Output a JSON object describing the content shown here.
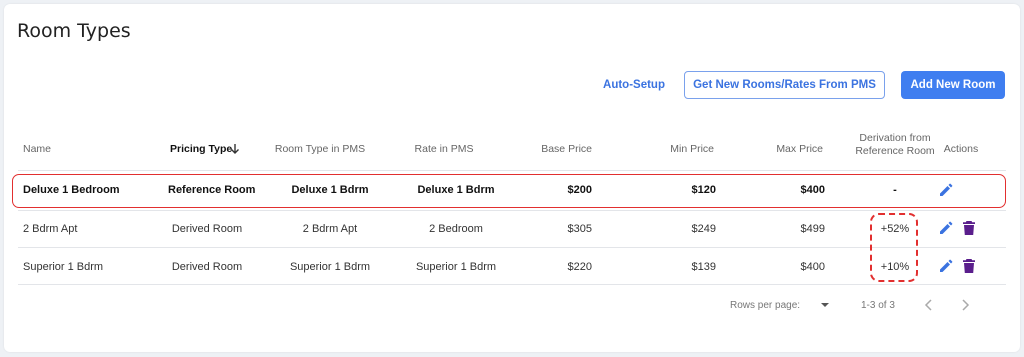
{
  "page": {
    "title": "Room Types"
  },
  "toolbar": {
    "auto_setup": "Auto-Setup",
    "get_new": "Get New Rooms/Rates From PMS",
    "add_new": "Add New Room"
  },
  "table": {
    "columns": {
      "name": "Name",
      "pricing_type": "Pricing Type",
      "room_type_pms": "Room Type in PMS",
      "rate_pms": "Rate in PMS",
      "base_price": "Base Price",
      "min_price": "Min Price",
      "max_price": "Max Price",
      "derivation_line1": "Derivation from",
      "derivation_line2": "Reference Room",
      "actions": "Actions"
    },
    "rows": [
      {
        "name": "Deluxe 1 Bedroom",
        "pricing_type": "Reference Room",
        "room_type_pms": "Deluxe 1 Bdrm",
        "rate_pms": "Deluxe 1 Bdrm",
        "base_price": "$200",
        "min_price": "$120",
        "max_price": "$400",
        "derivation": "-"
      },
      {
        "name": "2 Bdrm Apt",
        "pricing_type": "Derived Room",
        "room_type_pms": "2 Bdrm Apt",
        "rate_pms": "2 Bedroom",
        "base_price": "$305",
        "min_price": "$249",
        "max_price": "$499",
        "derivation": "+52%"
      },
      {
        "name": "Superior 1 Bdrm",
        "pricing_type": "Derived Room",
        "room_type_pms": "Superior 1 Bdrm",
        "rate_pms": "Superior 1 Bdrm",
        "base_price": "$220",
        "min_price": "$139",
        "max_price": "$400",
        "derivation": "+10%"
      }
    ]
  },
  "footer": {
    "rows_per_page_label": "Rows per page:",
    "range": "1-3 of 3"
  },
  "icons": {
    "edit": "edit-pencil-icon",
    "delete": "trash-icon",
    "sort": "arrow-down-icon"
  },
  "colors": {
    "accent": "#3f7ef0",
    "edit": "#3b73e0",
    "delete": "#5a1e8c",
    "highlight": "#e22f2f"
  }
}
